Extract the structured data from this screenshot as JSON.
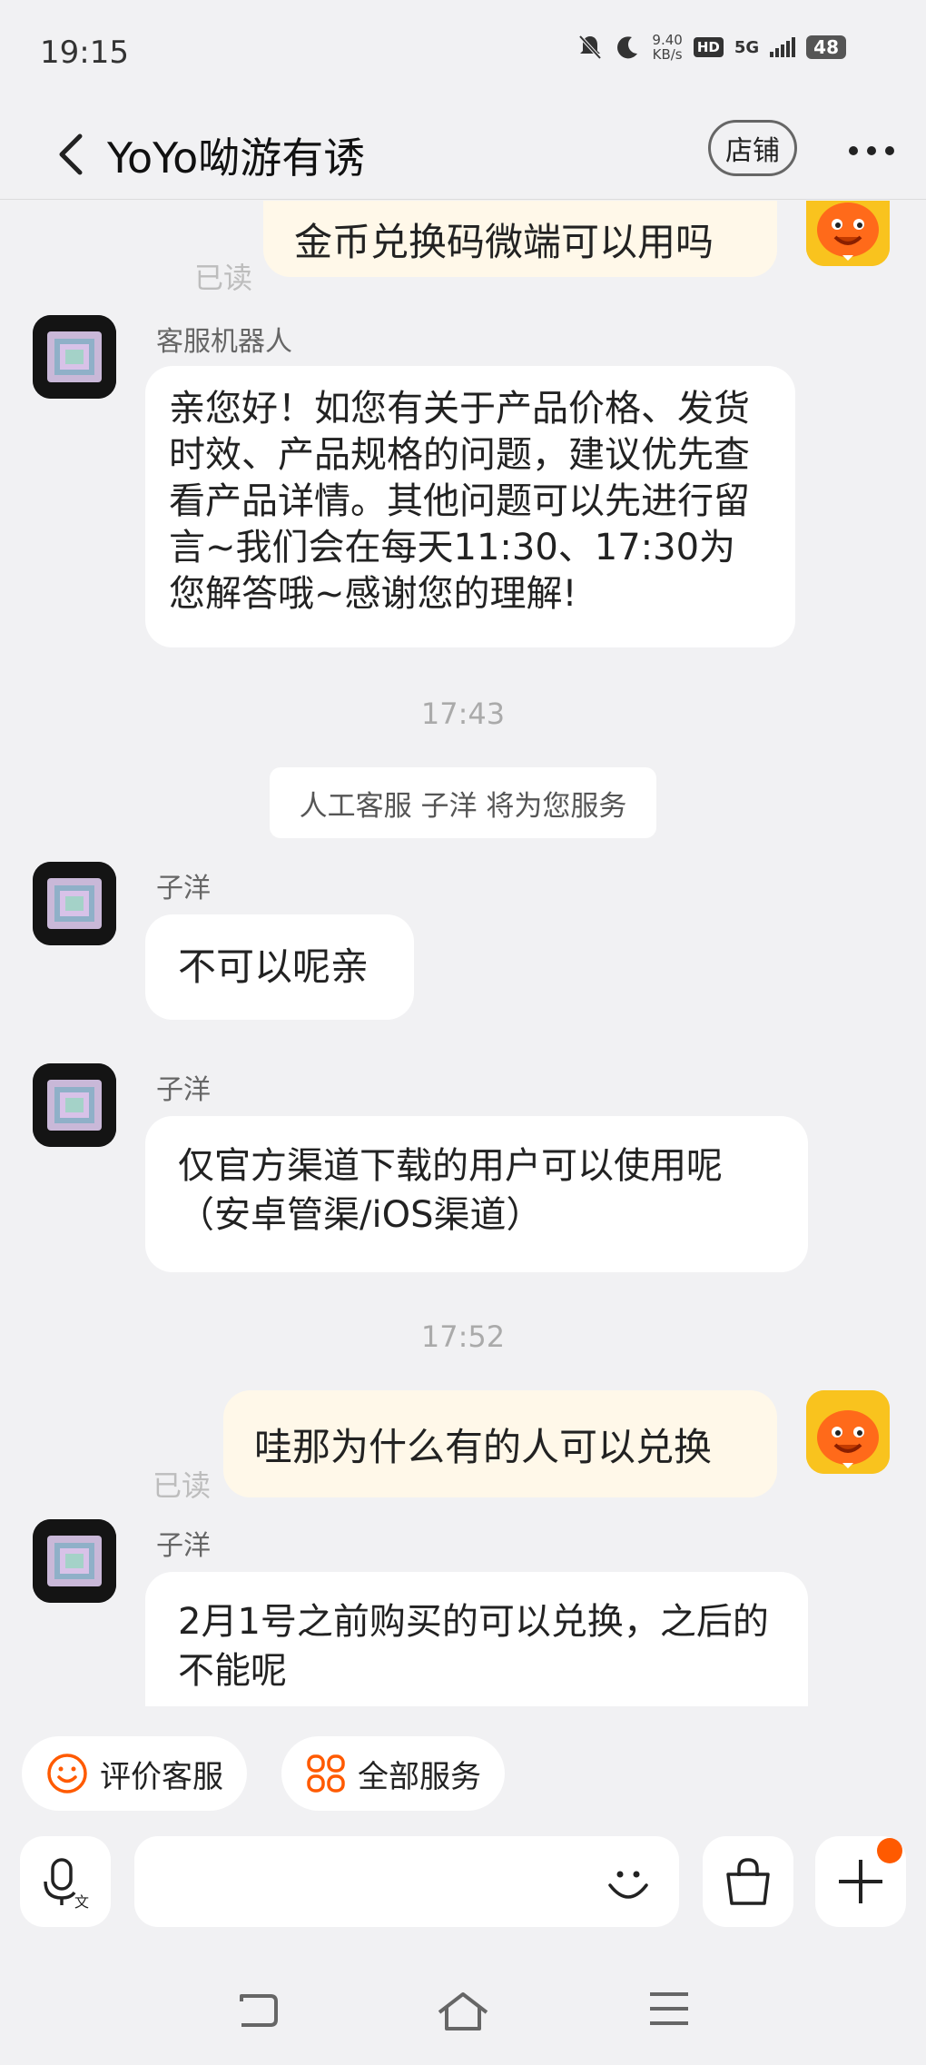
{
  "status_bar": {
    "time": "19:15",
    "net_speed_value": "9.40",
    "net_speed_unit": "KB/s",
    "hd": "HD",
    "network": "5G",
    "battery": "48"
  },
  "header": {
    "title": "YoYo呦游有诱",
    "shop_label": "店铺"
  },
  "chat": {
    "messages": [
      {
        "type": "outgoing",
        "text": "金币兑换码微端可以用吗",
        "read": "已读"
      },
      {
        "type": "incoming",
        "sender": "客服机器人",
        "text": "亲您好！如您有关于产品价格、发货时效、产品规格的问题，建议优先查看产品详情。其他问题可以先进行留言~我们会在每天11:30、17:30为您解答哦~感谢您的理解!"
      },
      {
        "type": "time",
        "text": "17:43"
      },
      {
        "type": "system",
        "text": "人工客服 子洋 将为您服务"
      },
      {
        "type": "incoming",
        "sender": "子洋",
        "text": "不可以呢亲"
      },
      {
        "type": "incoming",
        "sender": "子洋",
        "text": "仅官方渠道下载的用户可以使用呢（安卓管渠/iOS渠道）"
      },
      {
        "type": "time",
        "text": "17:52"
      },
      {
        "type": "outgoing",
        "text": "哇那为什么有的人可以兑换",
        "read": "已读"
      },
      {
        "type": "incoming",
        "sender": "子洋",
        "text": "2月1号之前购买的可以兑换，之后的不能呢"
      }
    ]
  },
  "quick_actions": [
    {
      "label": "评价客服",
      "icon": "smile-icon"
    },
    {
      "label": "全部服务",
      "icon": "grid-icon"
    }
  ],
  "input_bar": {
    "voice_icon": "microphone-icon",
    "voice_sub": "文",
    "placeholder": "",
    "emoji_icon": "emoji-icon",
    "bag_icon": "shopping-bag-icon",
    "plus_icon": "plus-icon"
  },
  "colors": {
    "accent": "#ff5a00",
    "outgoing_bubble": "#fff8e9",
    "background": "#f1f1f3"
  }
}
